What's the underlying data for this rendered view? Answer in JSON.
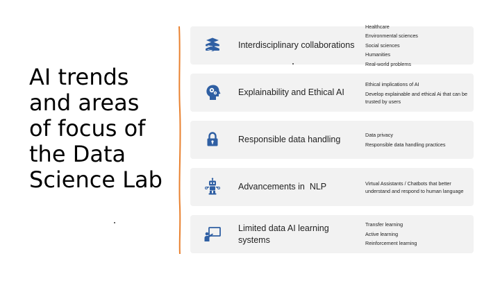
{
  "slide": {
    "title_lines": [
      "AI trends",
      "and areas",
      "of focus of",
      "the Data",
      "Science Lab"
    ],
    "accent_color": "#e9812f",
    "icon_color": "#2f5fa3",
    "items": [
      {
        "icon": "books-icon",
        "label": "Interdisciplinary collaborations",
        "details": [
          "Healthcare",
          "Environmental sciences",
          "Social sciences",
          "Humanities",
          "Real-world problems"
        ]
      },
      {
        "icon": "head-gears-icon",
        "label": "Explainability and Ethical AI",
        "details": [
          "Ethical implications of AI",
          "Develop explainable and ethical Ai that can be trusted by users"
        ]
      },
      {
        "icon": "lock-icon",
        "label": "Responsible data handling",
        "details": [
          "Data privacy",
          "Responsible data handling practices"
        ]
      },
      {
        "icon": "robot-icon",
        "label": "Advancements in  NLP",
        "details": [
          "Virtual Assistants / Chatbots that better understand and respond to human language"
        ]
      },
      {
        "icon": "teacher-board-icon",
        "label": "Limited data AI learning systems",
        "details": [
          "Transfer learning",
          "Active learning",
          "Reinforcement learning"
        ]
      }
    ]
  }
}
